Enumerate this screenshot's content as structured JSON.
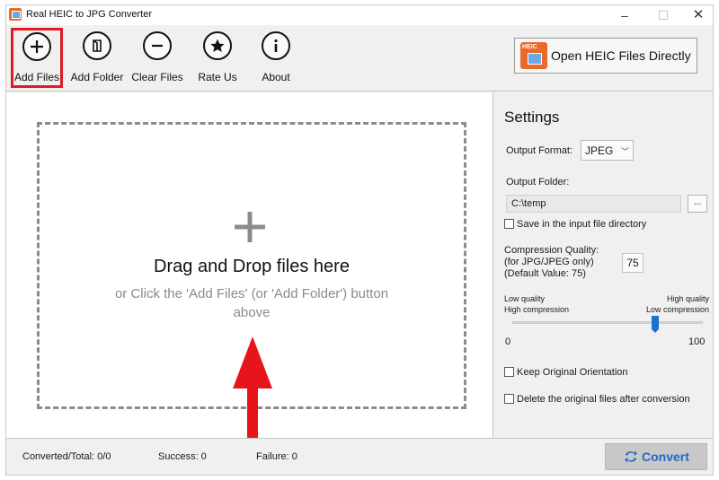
{
  "window": {
    "title": "Real HEIC to JPG Converter",
    "minimize": "–",
    "maximize": "☐",
    "close": "✕"
  },
  "toolbar": {
    "add_files": "Add Files",
    "add_folder": "Add Folder",
    "clear_files": "Clear Files",
    "rate_us": "Rate Us",
    "about": "About",
    "open_heic": "Open HEIC Files Directly",
    "heic_badge": "HEIC"
  },
  "drop_area": {
    "title": "Drag and Drop files here",
    "hint": "or Click the 'Add Files' (or 'Add Folder') button above"
  },
  "settings": {
    "title": "Settings",
    "output_format_label": "Output Format:",
    "output_format_value": "JPEG",
    "output_folder_label": "Output Folder:",
    "output_folder_value": "C:\\temp",
    "browse": "...",
    "save_in_input": "Save in the input file directory",
    "compression_label_1": "Compression Quality:",
    "compression_label_2": "(for JPG/JPEG only)",
    "compression_label_3": "(Default Value: 75)",
    "quality_value": "75",
    "low_quality": "Low quality",
    "high_compression": "High compression",
    "high_quality": "High quality",
    "low_compression": "Low compression",
    "slider_min": "0",
    "slider_max": "100",
    "slider_value": 75,
    "keep_orientation": "Keep Original Orientation",
    "delete_original": "Delete the original files after conversion"
  },
  "status": {
    "converted": "Converted/Total: 0/0",
    "success": "Success: 0",
    "failure": "Failure: 0",
    "convert": "Convert"
  },
  "colors": {
    "highlight": "#e01b24",
    "accent": "#2467c7",
    "arrow": "#e8141c"
  }
}
